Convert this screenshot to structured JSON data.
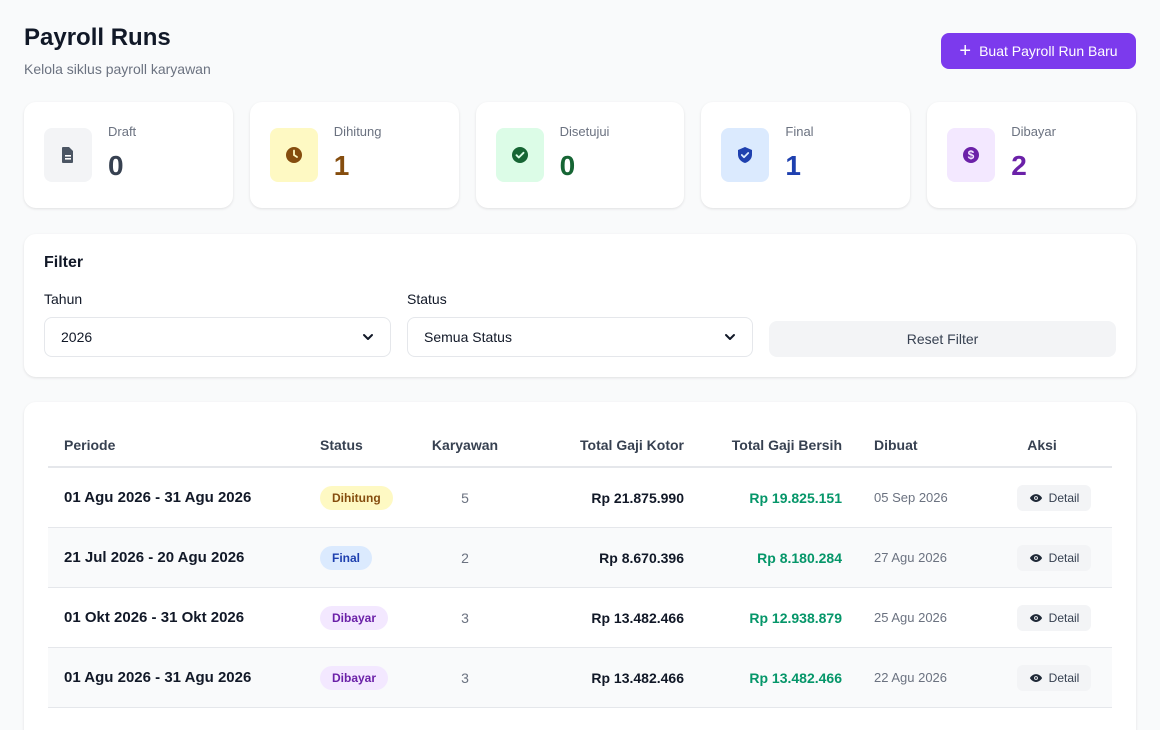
{
  "header": {
    "title": "Payroll Runs",
    "subtitle": "Kelola siklus payroll karyawan",
    "new_button_label": "Buat Payroll Run Baru"
  },
  "stats": [
    {
      "label": "Draft",
      "value": "0",
      "icon": "document-icon",
      "icon_bg": "#f3f4f6",
      "icon_color": "#4b5563",
      "value_color": "#374151"
    },
    {
      "label": "Dihitung",
      "value": "1",
      "icon": "clock-icon",
      "icon_bg": "#fef9c3",
      "icon_color": "#854d0e",
      "value_color": "#854d0e"
    },
    {
      "label": "Disetujui",
      "value": "0",
      "icon": "check-circle-icon",
      "icon_bg": "#dcfce7",
      "icon_color": "#166534",
      "value_color": "#166534"
    },
    {
      "label": "Final",
      "value": "1",
      "icon": "shield-icon",
      "icon_bg": "#dbeafe",
      "icon_color": "#1e40af",
      "value_color": "#1e40af"
    },
    {
      "label": "Dibayar",
      "value": "2",
      "icon": "dollar-circle-icon",
      "icon_bg": "#f3e8ff",
      "icon_color": "#6b21a8",
      "value_color": "#6b21a8"
    }
  ],
  "filter": {
    "title": "Filter",
    "year_label": "Tahun",
    "year_value": "2026",
    "status_label": "Status",
    "status_value": "Semua Status",
    "reset_label": "Reset Filter"
  },
  "table": {
    "headers": {
      "periode": "Periode",
      "status": "Status",
      "karyawan": "Karyawan",
      "kotor": "Total Gaji Kotor",
      "bersih": "Total Gaji Bersih",
      "dibuat": "Dibuat",
      "aksi": "Aksi"
    },
    "detail_label": "Detail",
    "rows": [
      {
        "periode": "01 Agu 2026 - 31 Agu 2026",
        "status": "Dihitung",
        "status_bg": "#fef9c3",
        "status_color": "#854d0e",
        "karyawan": "5",
        "kotor": "Rp 21.875.990",
        "bersih": "Rp 19.825.151",
        "dibuat": "05 Sep 2026"
      },
      {
        "periode": "21 Jul 2026 - 20 Agu 2026",
        "status": "Final",
        "status_bg": "#dbeafe",
        "status_color": "#1e40af",
        "karyawan": "2",
        "kotor": "Rp 8.670.396",
        "bersih": "Rp 8.180.284",
        "dibuat": "27 Agu 2026"
      },
      {
        "periode": "01 Okt 2026 - 31 Okt 2026",
        "status": "Dibayar",
        "status_bg": "#f3e8ff",
        "status_color": "#6b21a8",
        "karyawan": "3",
        "kotor": "Rp 13.482.466",
        "bersih": "Rp 12.938.879",
        "dibuat": "25 Agu 2026"
      },
      {
        "periode": "01 Agu 2026 - 31 Agu 2026",
        "status": "Dibayar",
        "status_bg": "#f3e8ff",
        "status_color": "#6b21a8",
        "karyawan": "3",
        "kotor": "Rp 13.482.466",
        "bersih": "Rp 13.482.466",
        "dibuat": "22 Agu 2026"
      }
    ]
  }
}
